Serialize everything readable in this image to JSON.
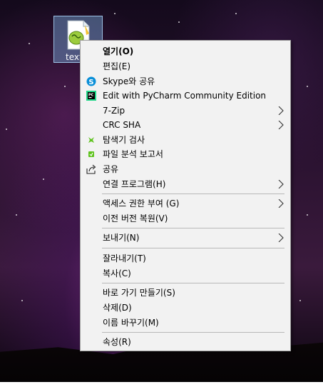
{
  "desktop": {
    "file": {
      "label": "text",
      "icon": "notepad-plus-plus-file-icon"
    }
  },
  "menu": {
    "items": [
      {
        "key": "open",
        "label": "열기(O)",
        "bold": true,
        "icon": null,
        "submenu": false
      },
      {
        "key": "edit",
        "label": "편집(E)",
        "icon": null,
        "submenu": false
      },
      {
        "key": "skype",
        "label": "Skype와 공유",
        "icon": "skype-icon",
        "submenu": false
      },
      {
        "key": "pycharm",
        "label": "Edit with PyCharm Community Edition",
        "icon": "pycharm-icon",
        "submenu": false
      },
      {
        "key": "7zip",
        "label": "7-Zip",
        "icon": null,
        "submenu": true
      },
      {
        "key": "crc",
        "label": "CRC SHA",
        "icon": null,
        "submenu": true
      },
      {
        "key": "scan",
        "label": "탐색기 검사",
        "icon": "virus-scan-icon",
        "submenu": false
      },
      {
        "key": "report",
        "label": "파일 분석 보고서",
        "icon": "analysis-report-icon",
        "submenu": false
      },
      {
        "key": "share",
        "label": "공유",
        "icon": "share-icon",
        "submenu": false
      },
      {
        "key": "openwith",
        "label": "연결 프로그램(H)",
        "icon": null,
        "submenu": true
      },
      {
        "key": "access",
        "label": "액세스 권한 부여 (G)",
        "icon": null,
        "submenu": true
      },
      {
        "key": "restore",
        "label": "이전 버전 복원(V)",
        "icon": null,
        "submenu": false
      },
      {
        "key": "sendto",
        "label": "보내기(N)",
        "icon": null,
        "submenu": true
      },
      {
        "key": "cut",
        "label": "잘라내기(T)",
        "icon": null,
        "submenu": false
      },
      {
        "key": "copy",
        "label": "복사(C)",
        "icon": null,
        "submenu": false
      },
      {
        "key": "shortcut",
        "label": "바로 가기 만들기(S)",
        "icon": null,
        "submenu": false
      },
      {
        "key": "delete",
        "label": "삭제(D)",
        "icon": null,
        "submenu": false
      },
      {
        "key": "rename",
        "label": "이름 바꾸기(M)",
        "icon": null,
        "submenu": false
      },
      {
        "key": "properties",
        "label": "속성(R)",
        "icon": null,
        "submenu": false
      }
    ]
  },
  "colors": {
    "menu_bg": "#f2f2f2",
    "skype": "#0a8fd8",
    "scan_green": "#5fc31f"
  }
}
